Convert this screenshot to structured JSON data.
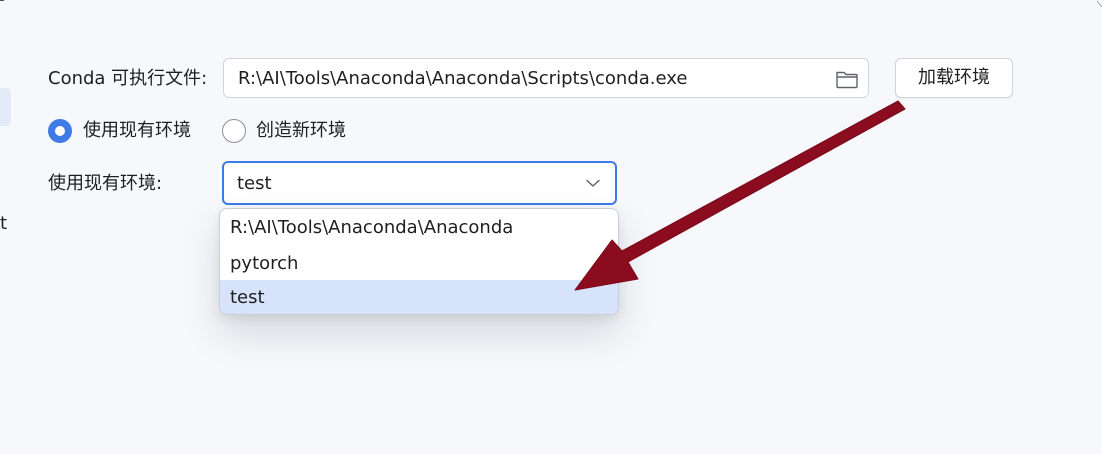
{
  "edge": {
    "partial_letter": "t"
  },
  "conda": {
    "label": "Conda 可执行文件:",
    "path_value": "R:\\AI\\Tools\\Anaconda\\Anaconda\\Scripts\\conda.exe",
    "browse_icon": "folder-icon"
  },
  "load_button": {
    "label": "加载环境"
  },
  "env_mode": {
    "options": [
      {
        "label": "使用现有环境",
        "selected": true
      },
      {
        "label": "创造新环境",
        "selected": false
      }
    ]
  },
  "existing_env": {
    "label": "使用现有环境:",
    "selected_value": "test",
    "dropdown_icon": "chevron-down-icon",
    "options": [
      {
        "label": "R:\\AI\\Tools\\Anaconda\\Anaconda",
        "highlighted": false
      },
      {
        "label": "pytorch",
        "highlighted": false
      },
      {
        "label": "test",
        "highlighted": true
      }
    ]
  },
  "annotation": {
    "type": "arrow",
    "color": "#8b0b1f",
    "from": "加载环境",
    "to": "test"
  },
  "colors": {
    "accent": "#3f7be6",
    "highlight": "#d7e2fb",
    "background": "#f6f8fb"
  }
}
